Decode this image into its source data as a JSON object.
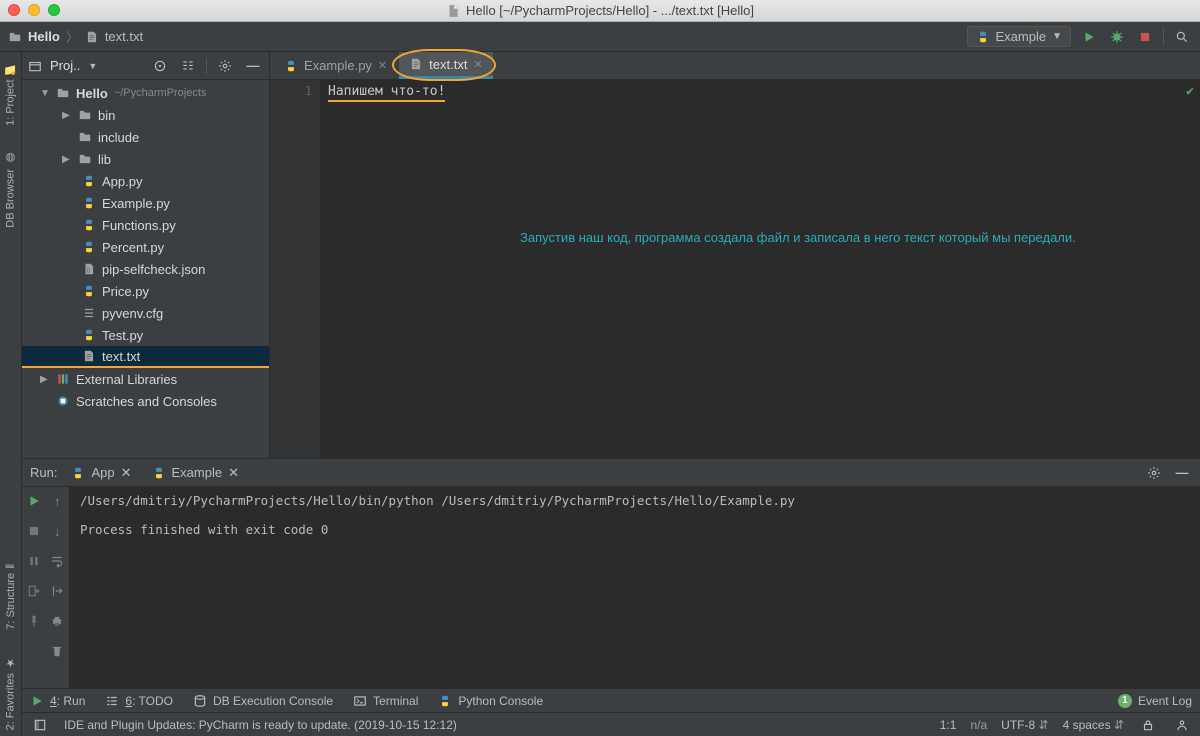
{
  "window": {
    "title": "Hello [~/PycharmProjects/Hello] - .../text.txt [Hello]"
  },
  "breadcrumb": {
    "project": "Hello",
    "file": "text.txt"
  },
  "run_config": {
    "label": "Example"
  },
  "project_panel": {
    "title": "Proj..",
    "root": {
      "name": "Hello",
      "path": "~/PycharmProjects"
    },
    "folders": [
      "bin",
      "include",
      "lib"
    ],
    "files": [
      "App.py",
      "Example.py",
      "Functions.py",
      "Percent.py",
      "pip-selfcheck.json",
      "Price.py",
      "pyvenv.cfg",
      "Test.py",
      "text.txt"
    ],
    "extlib": "External Libraries",
    "scratches": "Scratches and Consoles"
  },
  "editor": {
    "tabs": [
      {
        "label": "Example.py"
      },
      {
        "label": "text.txt"
      }
    ],
    "gutter": "1",
    "content_line1": "Напишем что-то!",
    "overlay": "Запустив наш код, программа создала файл и записала в него текст который мы передали."
  },
  "run": {
    "title": "Run:",
    "tabs": [
      {
        "label": "App"
      },
      {
        "label": "Example"
      }
    ],
    "out_line1": "/Users/dmitriy/PycharmProjects/Hello/bin/python /Users/dmitriy/PycharmProjects/Hello/Example.py",
    "out_line2": "Process finished with exit code 0"
  },
  "bottom": {
    "run": "4: Run",
    "todo": "6: TODO",
    "db": "DB Execution Console",
    "terminal": "Terminal",
    "pyconsole": "Python Console",
    "eventlog": "Event Log",
    "event_badge": "1"
  },
  "left_rail": {
    "project": "1: Project",
    "db": "DB Browser",
    "structure": "7: Structure",
    "favorites": "2: Favorites"
  },
  "status": {
    "msg": "IDE and Plugin Updates: PyCharm is ready to update. (2019-10-15 12:12)",
    "pos": "1:1",
    "na": "n/a",
    "enc": "UTF-8",
    "indent": "4 spaces"
  }
}
